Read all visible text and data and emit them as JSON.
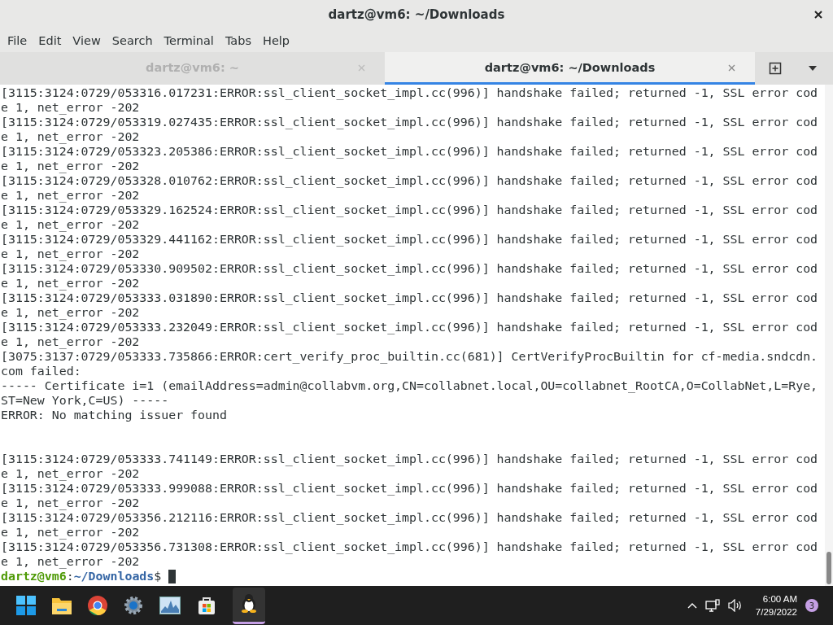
{
  "window": {
    "title": "dartz@vm6: ~/Downloads"
  },
  "menu": [
    "File",
    "Edit",
    "View",
    "Search",
    "Terminal",
    "Tabs",
    "Help"
  ],
  "tabs": [
    {
      "label": "dartz@vm6: ~",
      "selected": false
    },
    {
      "label": "dartz@vm6: ~/Downloads",
      "selected": true
    }
  ],
  "terminal": {
    "lines": [
      {
        "kind": "text",
        "text": "[3115:3124:0729/053316.017231:ERROR:ssl_client_socket_impl.cc(996)] handshake failed; returned -1, SSL error cod"
      },
      {
        "kind": "text",
        "text": "e 1, net_error -202"
      },
      {
        "kind": "text",
        "text": "[3115:3124:0729/053319.027435:ERROR:ssl_client_socket_impl.cc(996)] handshake failed; returned -1, SSL error cod"
      },
      {
        "kind": "text",
        "text": "e 1, net_error -202"
      },
      {
        "kind": "text",
        "text": "[3115:3124:0729/053323.205386:ERROR:ssl_client_socket_impl.cc(996)] handshake failed; returned -1, SSL error cod"
      },
      {
        "kind": "text",
        "text": "e 1, net_error -202"
      },
      {
        "kind": "text",
        "text": "[3115:3124:0729/053328.010762:ERROR:ssl_client_socket_impl.cc(996)] handshake failed; returned -1, SSL error cod"
      },
      {
        "kind": "text",
        "text": "e 1, net_error -202"
      },
      {
        "kind": "text",
        "text": "[3115:3124:0729/053329.162524:ERROR:ssl_client_socket_impl.cc(996)] handshake failed; returned -1, SSL error cod"
      },
      {
        "kind": "text",
        "text": "e 1, net_error -202"
      },
      {
        "kind": "text",
        "text": "[3115:3124:0729/053329.441162:ERROR:ssl_client_socket_impl.cc(996)] handshake failed; returned -1, SSL error cod"
      },
      {
        "kind": "text",
        "text": "e 1, net_error -202"
      },
      {
        "kind": "text",
        "text": "[3115:3124:0729/053330.909502:ERROR:ssl_client_socket_impl.cc(996)] handshake failed; returned -1, SSL error cod"
      },
      {
        "kind": "text",
        "text": "e 1, net_error -202"
      },
      {
        "kind": "text",
        "text": "[3115:3124:0729/053333.031890:ERROR:ssl_client_socket_impl.cc(996)] handshake failed; returned -1, SSL error cod"
      },
      {
        "kind": "text",
        "text": "e 1, net_error -202"
      },
      {
        "kind": "text",
        "text": "[3115:3124:0729/053333.232049:ERROR:ssl_client_socket_impl.cc(996)] handshake failed; returned -1, SSL error cod"
      },
      {
        "kind": "text",
        "text": "e 1, net_error -202"
      },
      {
        "kind": "text",
        "text": "[3075:3137:0729/053333.735866:ERROR:cert_verify_proc_builtin.cc(681)] CertVerifyProcBuiltin for cf-media.sndcdn."
      },
      {
        "kind": "text",
        "text": "com failed:"
      },
      {
        "kind": "text",
        "text": "----- Certificate i=1 (emailAddress=admin@collabvm.org,CN=collabnet.local,OU=collabnet_RootCA,O=CollabNet,L=Rye,"
      },
      {
        "kind": "text",
        "text": "ST=New York,C=US) -----"
      },
      {
        "kind": "text",
        "text": "ERROR: No matching issuer found"
      },
      {
        "kind": "blank"
      },
      {
        "kind": "blank"
      },
      {
        "kind": "text",
        "text": "[3115:3124:0729/053333.741149:ERROR:ssl_client_socket_impl.cc(996)] handshake failed; returned -1, SSL error cod"
      },
      {
        "kind": "text",
        "text": "e 1, net_error -202"
      },
      {
        "kind": "text",
        "text": "[3115:3124:0729/053333.999088:ERROR:ssl_client_socket_impl.cc(996)] handshake failed; returned -1, SSL error cod"
      },
      {
        "kind": "text",
        "text": "e 1, net_error -202"
      },
      {
        "kind": "text",
        "text": "[3115:3124:0729/053356.212116:ERROR:ssl_client_socket_impl.cc(996)] handshake failed; returned -1, SSL error cod"
      },
      {
        "kind": "text",
        "text": "e 1, net_error -202"
      },
      {
        "kind": "text",
        "text": "[3115:3124:0729/053356.731308:ERROR:ssl_client_socket_impl.cc(996)] handshake failed; returned -1, SSL error cod"
      },
      {
        "kind": "text",
        "text": "e 1, net_error -202"
      }
    ],
    "prompt": {
      "user_host": "dartz@vm6",
      "separator": ":",
      "path": "~/Downloads",
      "symbol": "$"
    }
  },
  "taskbar": {
    "time": "6:00 AM",
    "date": "7/29/2022",
    "notifications": "3"
  }
}
